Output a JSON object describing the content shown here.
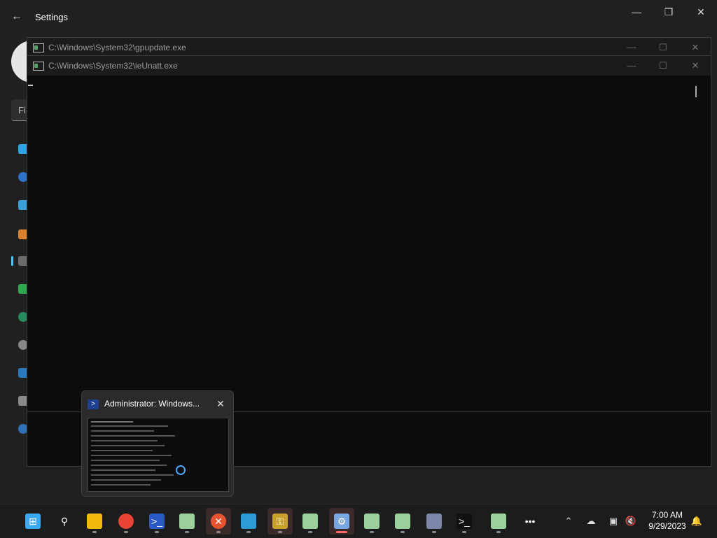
{
  "settings": {
    "title": "Settings",
    "back_icon": "←",
    "min_icon": "—",
    "restore_icon": "❐",
    "close_icon": "✕",
    "find_placeholder": "Fi"
  },
  "consoles": [
    {
      "title": "C:\\Windows\\System32\\gpupdate.exe"
    },
    {
      "title": "C:\\Windows\\System32\\ieUnatt.exe"
    }
  ],
  "console_controls": {
    "min": "—",
    "max": "☐",
    "close": "✕"
  },
  "preview": {
    "title": "Administrator: Windows...",
    "close": "✕",
    "icon": "ps-icon"
  },
  "taskbar": {
    "items": [
      {
        "name": "start",
        "glyph": "⊞",
        "color": "#3da9f5"
      },
      {
        "name": "search",
        "glyph": "⚲",
        "color": "#1c1c1c"
      },
      {
        "name": "file-explorer",
        "glyph": "",
        "color": "#f2b90f"
      },
      {
        "name": "chrome",
        "glyph": "",
        "color": "#e94335"
      },
      {
        "name": "powershell",
        "glyph": ">_",
        "color": "#2a59c4"
      },
      {
        "name": "console-1",
        "glyph": "",
        "color": "#9bcf9b"
      },
      {
        "name": "x-app",
        "glyph": "✕",
        "color": "#e8532f"
      },
      {
        "name": "app-blue",
        "glyph": "",
        "color": "#2d9bd6"
      },
      {
        "name": "key-tool",
        "glyph": "⚿",
        "color": "#c9a02a"
      },
      {
        "name": "console-2",
        "glyph": "",
        "color": "#9bcf9b"
      },
      {
        "name": "settings-app",
        "glyph": "⚙",
        "color": "#7aa7e0"
      },
      {
        "name": "console-3",
        "glyph": "",
        "color": "#9bcf9b"
      },
      {
        "name": "console-4",
        "glyph": "",
        "color": "#9bcf9b"
      },
      {
        "name": "remote-tool",
        "glyph": "",
        "color": "#7b86a8"
      },
      {
        "name": "terminal",
        "glyph": ">_",
        "color": "#111"
      },
      {
        "name": "console-5",
        "glyph": "",
        "color": "#9bcf9b"
      },
      {
        "name": "more",
        "glyph": "•••",
        "color": "#1c1c1c"
      }
    ]
  },
  "tray": {
    "chevron": "⌃",
    "onedrive": "☁",
    "network": "▣",
    "volume": "🔇",
    "bell": "🔔"
  },
  "clock": {
    "time": "7:00 AM",
    "date": "9/29/2023"
  }
}
